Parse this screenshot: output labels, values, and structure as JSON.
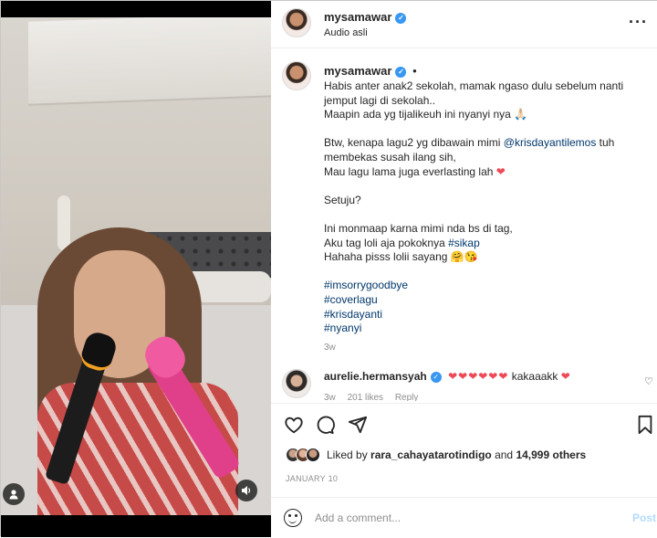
{
  "header": {
    "username": "mysamawar",
    "audio": "Audio asli",
    "more_icon": "more-dots-icon"
  },
  "caption": {
    "username": "mysamawar",
    "dot": "•",
    "lines": [
      "Habis anter anak2 sekolah, mamak ngaso dulu sebelum nanti",
      "jemput lagi di sekolah..",
      "Maapin ada yg tijalikeuh ini nyanyi nya 🙏🏻",
      "",
      "Btw, kenapa lagu2 yg dibawain mimi ",
      "membekas susah ilang sih,",
      "Mau lagu lama juga everlasting lah ",
      "",
      "Setuju?",
      "",
      "Ini monmaap karna mimi nda bs di tag,",
      "Aku tag loli aja pokoknya ",
      "Hahaha pisss lolii sayang 🤗😘",
      ""
    ],
    "mention": "@krisdayantilemos",
    "mention_tail": " tuh",
    "heart": "❤",
    "inline_tag": "#sikap",
    "hashtags": [
      "#imsorrygoodbye",
      "#coverlagu",
      "#krisdayanti",
      "#nyanyi"
    ],
    "age": "3w"
  },
  "comment": {
    "username": "aurelie.hermansyah",
    "hearts": "❤❤❤❤❤❤",
    "text": " kakaaakk ",
    "end_heart": "❤",
    "age": "3w",
    "likes": "201 likes",
    "reply": "Reply"
  },
  "actions": {
    "like_icon": "heart-outline-icon",
    "comment_icon": "comment-bubble-icon",
    "share_icon": "paper-plane-icon",
    "save_icon": "bookmark-icon"
  },
  "likes": {
    "prefix": "Liked by ",
    "user": "rara_cahayatarotindigo",
    "middle": " and ",
    "others": "14,999 others"
  },
  "date": "JANUARY 10",
  "add_comment": {
    "placeholder": "Add a comment...",
    "post_label": "Post"
  },
  "video": {
    "user_icon": "user-silhouette-icon",
    "sound_icon": "speaker-icon"
  },
  "colors": {
    "link": "#00376b",
    "verified": "#3897f0",
    "heart": "#ed4956",
    "post_disabled": "#b3dbff"
  }
}
